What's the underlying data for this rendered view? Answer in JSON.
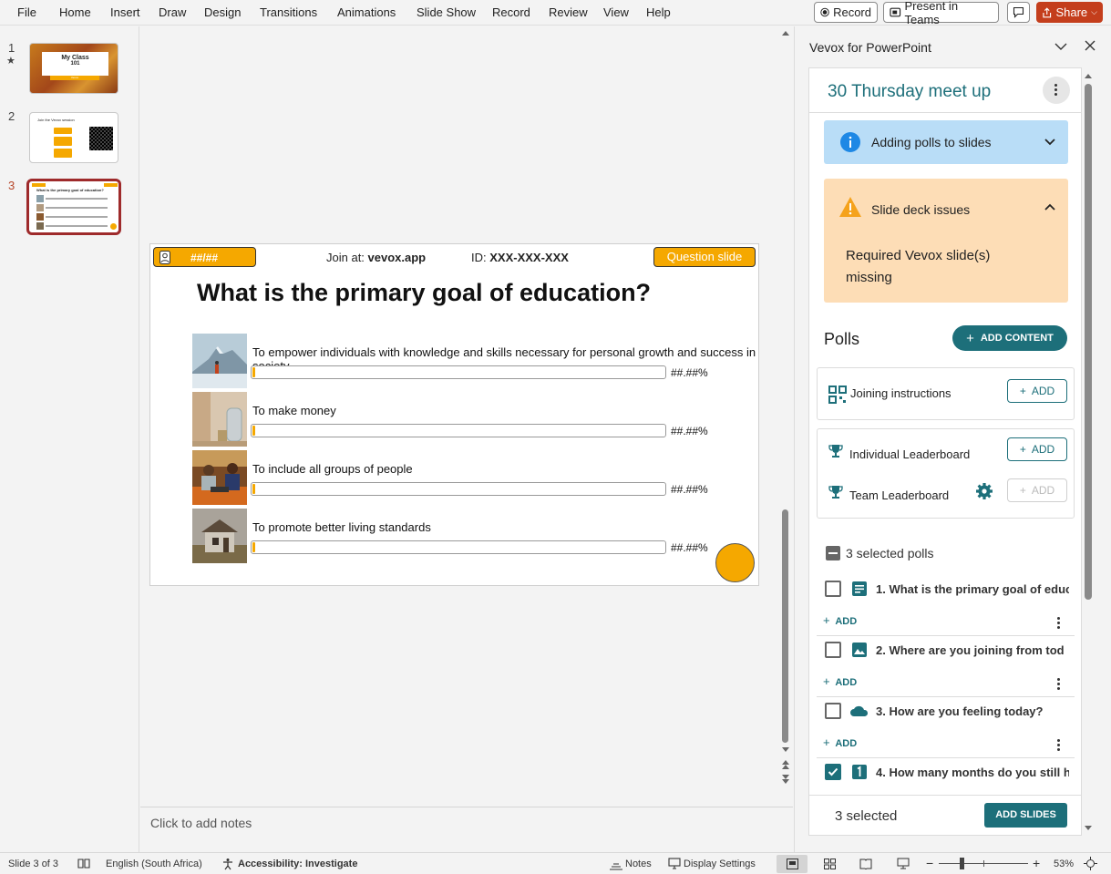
{
  "menu": [
    "File",
    "Home",
    "Insert",
    "Draw",
    "Design",
    "Transitions",
    "Animations",
    "Slide Show",
    "Record",
    "Review",
    "View",
    "Help"
  ],
  "toolbar": {
    "record_label": "Record",
    "present_label": "Present in Teams",
    "share_label": "Share"
  },
  "thumbnails": [
    {
      "number": "1",
      "title": "My Class",
      "subtitle": "101",
      "tag": "Vevox"
    },
    {
      "number": "2",
      "title": "Join the Vevox session"
    },
    {
      "number": "3",
      "title": "What is the primary goal of education?"
    }
  ],
  "slide": {
    "participants": "##/##",
    "join_prefix": "Join at: ",
    "join_url": "vevox.app",
    "id_prefix": "ID: ",
    "id_value": "XXX-XXX-XXX",
    "badge": "Question slide",
    "question": "What is the primary goal of education?",
    "options": [
      {
        "text": "To empower individuals with knowledge and skills necessary for personal growth and success in society",
        "pct": "##.##%",
        "img": "mountain"
      },
      {
        "text": "To make money",
        "pct": "##.##%",
        "img": "coins"
      },
      {
        "text": "To include all groups of people",
        "pct": "##.##%",
        "img": "people"
      },
      {
        "text": "To promote better living standards",
        "pct": "##.##%",
        "img": "house"
      }
    ]
  },
  "notes_placeholder": "Click to add notes",
  "pane": {
    "title": "Vevox for PowerPoint",
    "session_name": "30 Thursday meet up",
    "info_banner": "Adding polls to slides",
    "warning_title": "Slide deck issues",
    "warning_body": "Required Vevox slide(s) missing",
    "polls_heading": "Polls",
    "add_content_label": "ADD CONTENT",
    "add_label": "ADD",
    "joining_label": "Joining instructions",
    "individual_label": "Individual Leaderboard",
    "team_label": "Team Leaderboard",
    "selected_header": "3 selected polls",
    "polls": [
      {
        "title": "1. What is the primary goal of educ",
        "checked": false,
        "icon": "text-icon"
      },
      {
        "title": "2. Where are you joining from tod",
        "checked": false,
        "icon": "image-icon"
      },
      {
        "title": "3. How are you feeling today?",
        "checked": false,
        "icon": "cloud-icon"
      },
      {
        "title": "4. How many months do you still h",
        "checked": true,
        "icon": "number-icon"
      }
    ],
    "footer_selected": "3 selected",
    "add_slides_label": "ADD SLIDES",
    "accent": "#1d6f7a"
  },
  "status": {
    "slide_count": "Slide 3 of 3",
    "language": "English (South Africa)",
    "accessibility": "Accessibility: Investigate",
    "notes": "Notes",
    "display_settings": "Display Settings",
    "zoom": "53%"
  }
}
